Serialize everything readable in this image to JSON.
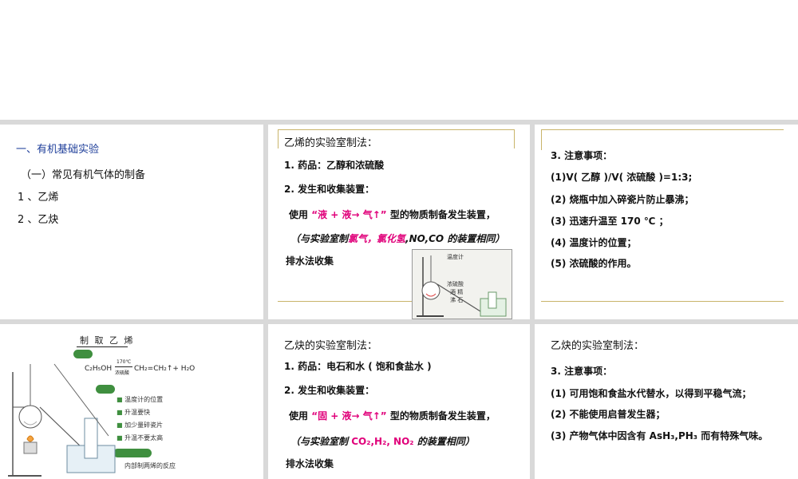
{
  "slide1": {
    "heading": "一、有机基础实验",
    "subheading": "（一）常见有机气体的制备",
    "item1": "1 、乙烯",
    "item2": "2 、乙炔"
  },
  "slide2": {
    "title": "乙烯的实验室制法：",
    "line1": "1. 药品：乙醇和浓硫酸",
    "line2": "2. 发生和收集装置：",
    "line3_prefix": "使用",
    "line3_red": "“液 + 液→ 气↑”",
    "line3_suffix": "型的物质制备发生装置，",
    "line4_prefix": "（与实验室制",
    "line4_red": "氯气，氯化氢",
    "line4_suffix": ",NO,CO 的装置相同）",
    "line5": "排水法收集",
    "figure_labels": {
      "thermometer": "温度计",
      "acid": "浓硫酸",
      "alcohol": "酒  精",
      "stone": "沸  石"
    }
  },
  "slide3": {
    "title": "3. 注意事项：",
    "items": [
      "(1)V( 乙醇 )/V( 浓硫酸 )=1:3;",
      "(2) 烧瓶中加入碎瓷片防止暴沸；",
      "(3) 迅速升温至 170 ℃ ；",
      "(4) 温度计的位置；",
      "(5) 浓硫酸的作用。"
    ]
  },
  "slide4": {
    "figure_title": "制 取 乙 烯",
    "reaction_left": "C₂H₅OH",
    "reaction_condition_top": "170℃",
    "reaction_condition_bottom": "浓硫酸",
    "reaction_right": "CH₂=CH₂↑+ H₂O",
    "notes": [
      "温度计的位置",
      "升温要快",
      "加少量碎瓷片",
      "升温不要太高"
    ],
    "bottom_note": "内部制两烯的反应"
  },
  "slide5": {
    "title": "乙炔的实验室制法：",
    "line1": "1. 药品：电石和水 ( 饱和食盐水 )",
    "line2": "2. 发生和收集装置：",
    "line3_prefix": "使用",
    "line3_red": "“固 + 液→ 气↑”",
    "line3_suffix": "型的物质制备发生装置，",
    "line4_prefix": "（与实验室制",
    "line4_red": "CO₂,H₂, NO₂",
    "line4_suffix": "的装置相同）",
    "line5": "排水法收集"
  },
  "slide6": {
    "title": "乙炔的实验室制法：",
    "line1": "3. 注意事项：",
    "line2": "(1) 可用饱和食盐水代替水，以得到平稳气流；",
    "line3": "(2) 不能使用启普发生器；",
    "line4": "(3) 产物气体中因含有 AsH₃,PH₃ 而有特殊气味。"
  }
}
